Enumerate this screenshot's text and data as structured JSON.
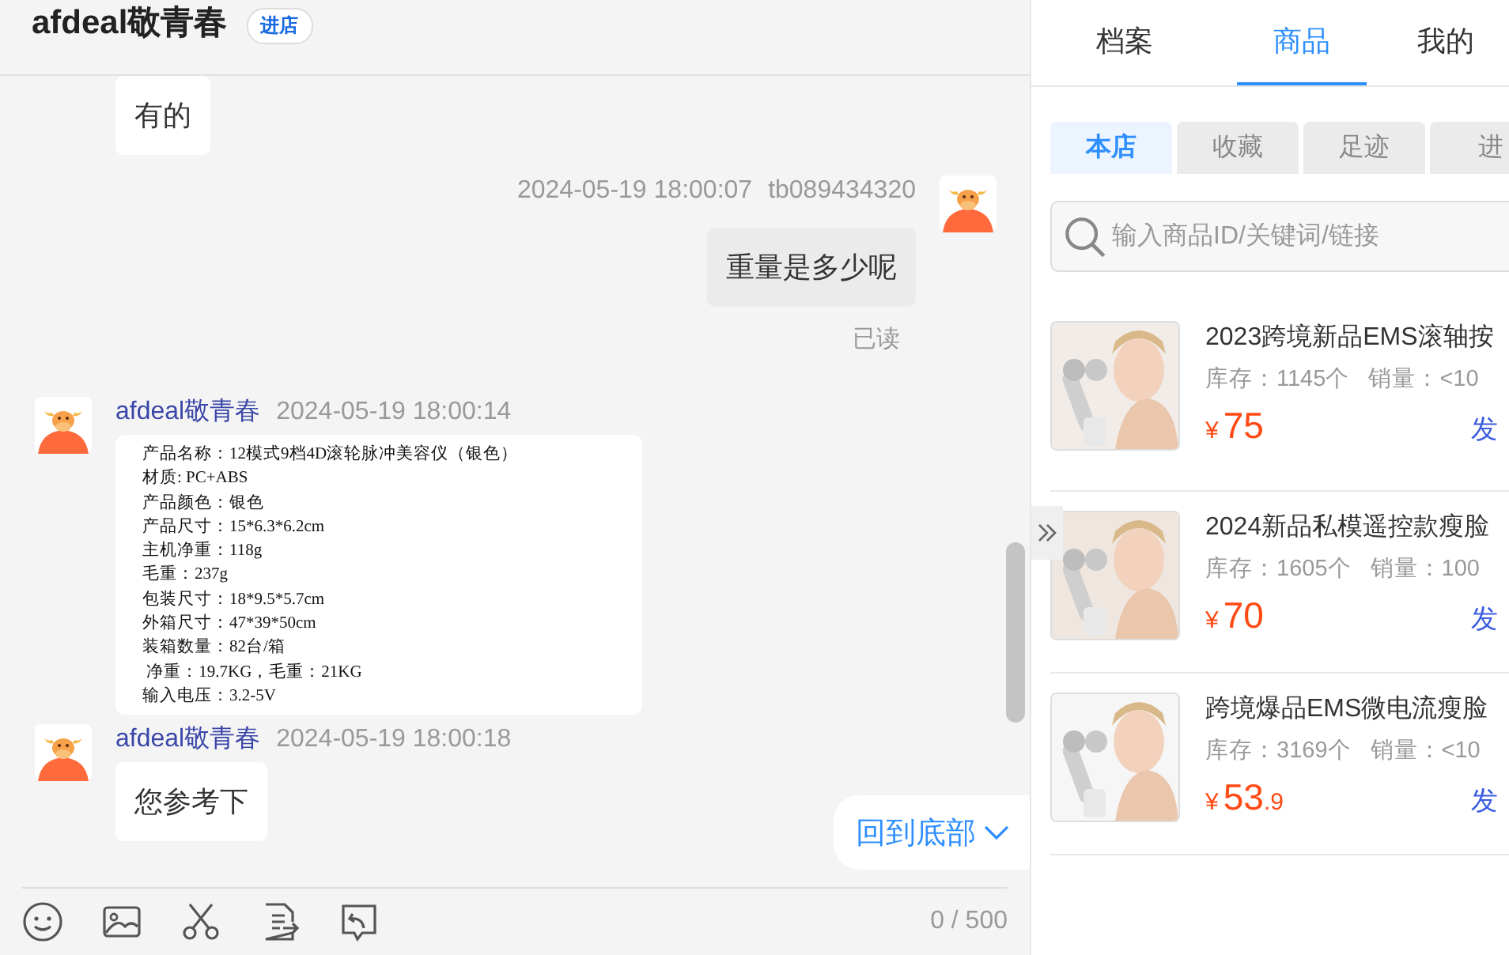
{
  "header": {
    "title": "afdeal敬青春",
    "store_button": "进店"
  },
  "messages": [
    {
      "outgoing": false,
      "kind": "text",
      "text": "有的"
    },
    {
      "outgoing": true,
      "kind": "text",
      "time": "2024-05-19 18:00:07",
      "sender": "tb089434320",
      "text": "重量是多少呢",
      "status": "已读"
    },
    {
      "outgoing": false,
      "kind": "document",
      "sender": "afdeal敬青春",
      "time": "2024-05-19 18:00:14",
      "lines": [
        "产品名称：12模式9档4D滚轮脉冲美容仪（银色）",
        "材质: PC+ABS",
        "产品颜色：银色",
        "产品尺寸：15*6.3*6.2cm",
        "主机净重：118g",
        "毛重：237g",
        "包装尺寸：18*9.5*5.7cm",
        "外箱尺寸：47*39*50cm",
        "装箱数量：82台/箱",
        " 净重：19.7KG，毛重：21KG",
        "输入电压：3.2-5V"
      ]
    },
    {
      "outgoing": false,
      "kind": "text",
      "sender": "afdeal敬青春",
      "time": "2024-05-19 18:00:18",
      "text": "您参考下"
    }
  ],
  "back_to_bottom": "回到底部",
  "composer": {
    "counter": "0 / 500"
  },
  "panel": {
    "tabs": [
      {
        "label": "档案",
        "selected": false
      },
      {
        "label": "商品",
        "selected": true
      },
      {
        "label": "我的",
        "selected": false
      }
    ],
    "subtabs": [
      {
        "label": "本店",
        "selected": true
      },
      {
        "label": "收藏",
        "selected": false
      },
      {
        "label": "足迹",
        "selected": false
      },
      {
        "label": "进",
        "selected": false
      }
    ],
    "search": {
      "placeholder": "输入商品ID/关键词/链接"
    },
    "products": [
      {
        "title": "2023跨境新品EMS滚轴按",
        "stock": "库存：1145个",
        "sales": "销量：<10",
        "currency": "¥",
        "price": "75",
        "action": "发"
      },
      {
        "title": "2024新品私模遥控款瘦脸",
        "stock": "库存：1605个",
        "sales": "销量：100",
        "currency": "¥",
        "price": "70",
        "action": "发"
      },
      {
        "title": "跨境爆品EMS微电流瘦脸",
        "stock": "库存：3169个",
        "sales": "销量：<10",
        "currency": "¥",
        "price": "53",
        "price_decimal": ".9",
        "action": "发"
      }
    ]
  }
}
